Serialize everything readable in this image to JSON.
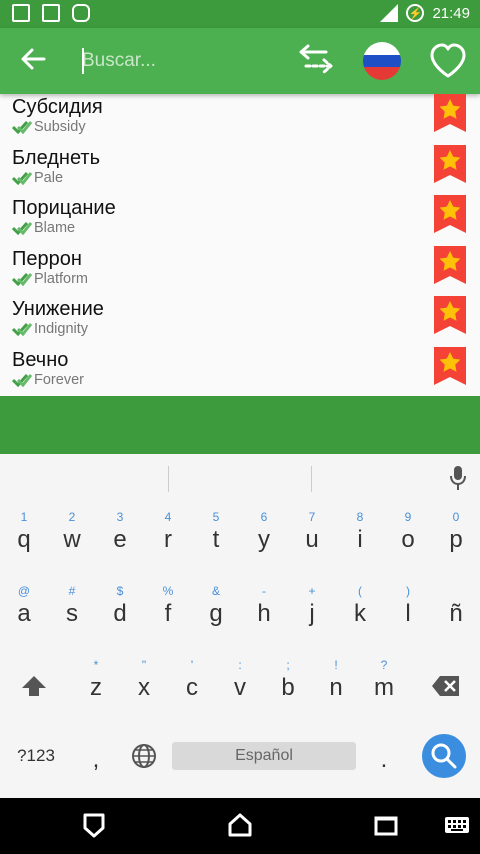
{
  "status": {
    "time": "21:49"
  },
  "toolbar": {
    "search_placeholder": "Buscar..."
  },
  "words": [
    {
      "ru": "Субсидия",
      "en": "Subsidy"
    },
    {
      "ru": "Бледнеть",
      "en": "Pale"
    },
    {
      "ru": "Порицание",
      "en": "Blame"
    },
    {
      "ru": "Перрон",
      "en": "Platform"
    },
    {
      "ru": "Унижение",
      "en": "Indignity"
    },
    {
      "ru": "Вечно",
      "en": "Forever"
    }
  ],
  "keyboard": {
    "row1": [
      {
        "k": "q",
        "h": "1"
      },
      {
        "k": "w",
        "h": "2"
      },
      {
        "k": "e",
        "h": "3"
      },
      {
        "k": "r",
        "h": "4"
      },
      {
        "k": "t",
        "h": "5"
      },
      {
        "k": "y",
        "h": "6"
      },
      {
        "k": "u",
        "h": "7"
      },
      {
        "k": "i",
        "h": "8"
      },
      {
        "k": "o",
        "h": "9"
      },
      {
        "k": "p",
        "h": "0"
      }
    ],
    "row2": [
      {
        "k": "a",
        "h": "@"
      },
      {
        "k": "s",
        "h": "#"
      },
      {
        "k": "d",
        "h": "$"
      },
      {
        "k": "f",
        "h": "%"
      },
      {
        "k": "g",
        "h": "&"
      },
      {
        "k": "h",
        "h": "-"
      },
      {
        "k": "j",
        "h": "+"
      },
      {
        "k": "k",
        "h": "("
      },
      {
        "k": "l",
        "h": ")"
      },
      {
        "k": "ñ",
        "h": ""
      }
    ],
    "row3": [
      {
        "k": "z",
        "h": "*"
      },
      {
        "k": "x",
        "h": "\""
      },
      {
        "k": "c",
        "h": "'"
      },
      {
        "k": "v",
        "h": ":"
      },
      {
        "k": "b",
        "h": ";"
      },
      {
        "k": "n",
        "h": "!"
      },
      {
        "k": "m",
        "h": "?"
      }
    ],
    "symbols_label": "?123",
    "comma": ",",
    "space_label": "Español",
    "period": "."
  },
  "colors": {
    "primary": "#4caf50",
    "status": "#3d9a3d",
    "ribbon": "#f44336",
    "star": "#ffc107",
    "enter": "#3b8de0"
  }
}
